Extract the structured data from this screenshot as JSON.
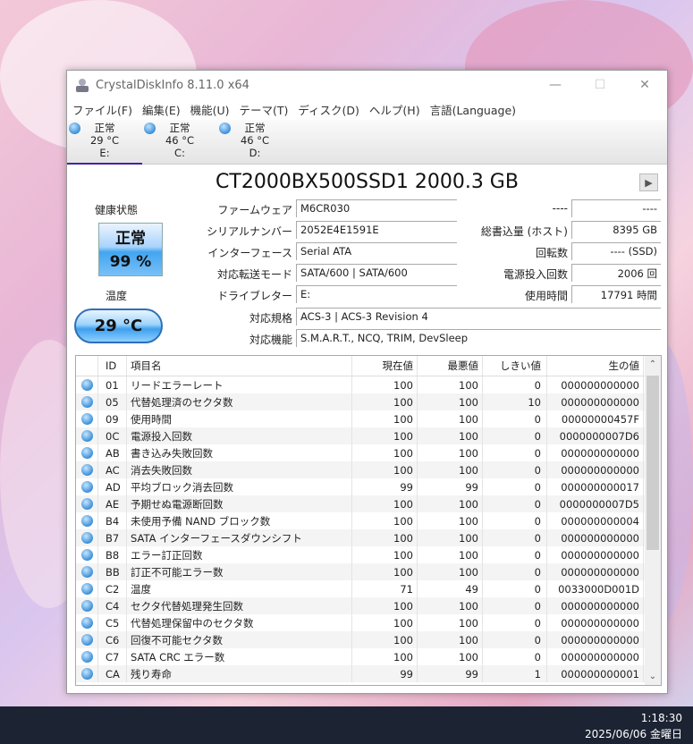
{
  "window": {
    "title": "CrystalDiskInfo 8.11.0 x64",
    "minimize": "—",
    "maximize": "☐",
    "close": "✕"
  },
  "menu": [
    "ファイル(F)",
    "編集(E)",
    "機能(U)",
    "テーマ(T)",
    "ディスク(D)",
    "ヘルプ(H)",
    "言語(Language)"
  ],
  "drives": [
    {
      "status": "正常",
      "temp": "29 °C",
      "letter": "E:"
    },
    {
      "status": "正常",
      "temp": "46 °C",
      "letter": "C:"
    },
    {
      "status": "正常",
      "temp": "46 °C",
      "letter": "D:"
    }
  ],
  "model": "CT2000BX500SSD1 2000.3 GB",
  "health": {
    "label": "健康状態",
    "status": "正常",
    "percent": "99 %"
  },
  "temperature": {
    "label": "温度",
    "value": "29 °C"
  },
  "info_left": [
    {
      "label": "ファームウェア",
      "value": "M6CR030"
    },
    {
      "label": "シリアルナンバー",
      "value": "2052E4E1591E"
    },
    {
      "label": "インターフェース",
      "value": "Serial ATA"
    },
    {
      "label": "対応転送モード",
      "value": "SATA/600 | SATA/600"
    },
    {
      "label": "ドライブレター",
      "value": "E:"
    }
  ],
  "info_right": [
    {
      "label": "----",
      "value": "----"
    },
    {
      "label": "総書込量 (ホスト)",
      "value": "8395 GB"
    },
    {
      "label": "回転数",
      "value": "---- (SSD)"
    },
    {
      "label": "電源投入回数",
      "value": "2006 回"
    },
    {
      "label": "使用時間",
      "value": "17791 時間"
    }
  ],
  "info_wide": [
    {
      "label": "対応規格",
      "value": "ACS-3 | ACS-3 Revision 4"
    },
    {
      "label": "対応機能",
      "value": "S.M.A.R.T., NCQ, TRIM, DevSleep"
    }
  ],
  "table": {
    "headers": [
      "ID",
      "項目名",
      "現在値",
      "最悪値",
      "しきい値",
      "生の値"
    ],
    "rows": [
      [
        "01",
        "リードエラーレート",
        "100",
        "100",
        "0",
        "000000000000"
      ],
      [
        "05",
        "代替処理済のセクタ数",
        "100",
        "100",
        "10",
        "000000000000"
      ],
      [
        "09",
        "使用時間",
        "100",
        "100",
        "0",
        "00000000457F"
      ],
      [
        "0C",
        "電源投入回数",
        "100",
        "100",
        "0",
        "0000000007D6"
      ],
      [
        "AB",
        "書き込み失敗回数",
        "100",
        "100",
        "0",
        "000000000000"
      ],
      [
        "AC",
        "消去失敗回数",
        "100",
        "100",
        "0",
        "000000000000"
      ],
      [
        "AD",
        "平均ブロック消去回数",
        "99",
        "99",
        "0",
        "000000000017"
      ],
      [
        "AE",
        "予期せぬ電源断回数",
        "100",
        "100",
        "0",
        "0000000007D5"
      ],
      [
        "B4",
        "未使用予備 NAND ブロック数",
        "100",
        "100",
        "0",
        "000000000004"
      ],
      [
        "B7",
        "SATA インターフェースダウンシフト",
        "100",
        "100",
        "0",
        "000000000000"
      ],
      [
        "B8",
        "エラー訂正回数",
        "100",
        "100",
        "0",
        "000000000000"
      ],
      [
        "BB",
        "訂正不可能エラー数",
        "100",
        "100",
        "0",
        "000000000000"
      ],
      [
        "C2",
        "温度",
        "71",
        "49",
        "0",
        "0033000D001D"
      ],
      [
        "C4",
        "セクタ代替処理発生回数",
        "100",
        "100",
        "0",
        "000000000000"
      ],
      [
        "C5",
        "代替処理保留中のセクタ数",
        "100",
        "100",
        "0",
        "000000000000"
      ],
      [
        "C6",
        "回復不可能セクタ数",
        "100",
        "100",
        "0",
        "000000000000"
      ],
      [
        "C7",
        "SATA CRC エラー数",
        "100",
        "100",
        "0",
        "000000000000"
      ],
      [
        "CA",
        "残り寿命",
        "99",
        "99",
        "1",
        "000000000001"
      ]
    ]
  },
  "taskbar": {
    "time": "1:18:30",
    "date": "2025/06/06 金曜日"
  }
}
